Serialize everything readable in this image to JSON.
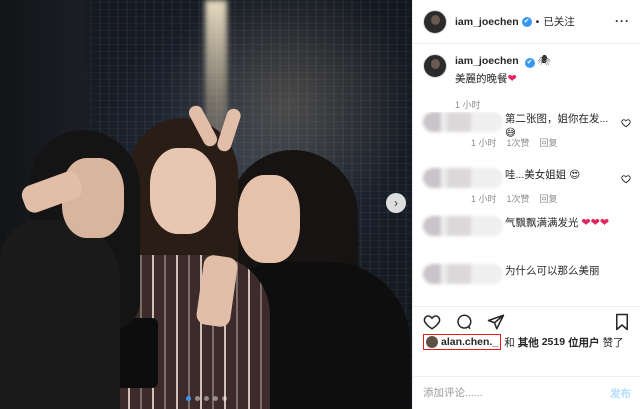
{
  "header": {
    "username": "iam_joechen",
    "verified_mark": "✔",
    "separator": "•",
    "follow_status": "已关注",
    "more_label": "···"
  },
  "caption": {
    "username": "iam_joechen",
    "extra_mark": "🕷",
    "text": "美麗的晚餐",
    "heart": "❤",
    "time": "1 小时"
  },
  "comments": [
    {
      "text": "第二张图，姐你在发...",
      "emoji": "😅",
      "time": "1 小时",
      "likes": "1次赞",
      "reply": "回复"
    },
    {
      "text": "哇...美女姐姐",
      "emoji": "😍",
      "time": "1 小时",
      "likes": "1次赞",
      "reply": "回复"
    },
    {
      "text": "气飘飘满满发光",
      "hearts": "❤❤❤",
      "time": "",
      "likes": "",
      "reply": ""
    },
    {
      "text": "为什么可以那么美丽",
      "time": "",
      "likes": "",
      "reply": ""
    }
  ],
  "likes": {
    "user": "alan.chen._",
    "and": "和",
    "others_prefix": "其他",
    "count": "2519",
    "others_suffix": "位用户",
    "verb": "赞了"
  },
  "add_comment": {
    "placeholder": "添加评论......",
    "post_label": "发布"
  },
  "photo": {
    "next_arrow": "›",
    "slide_count": 5,
    "active_slide": 1
  },
  "colors": {
    "accent": "#3897f0",
    "highlight_box": "#e02020",
    "heart": "#e0245e",
    "post_disabled": "#b2dffc"
  }
}
